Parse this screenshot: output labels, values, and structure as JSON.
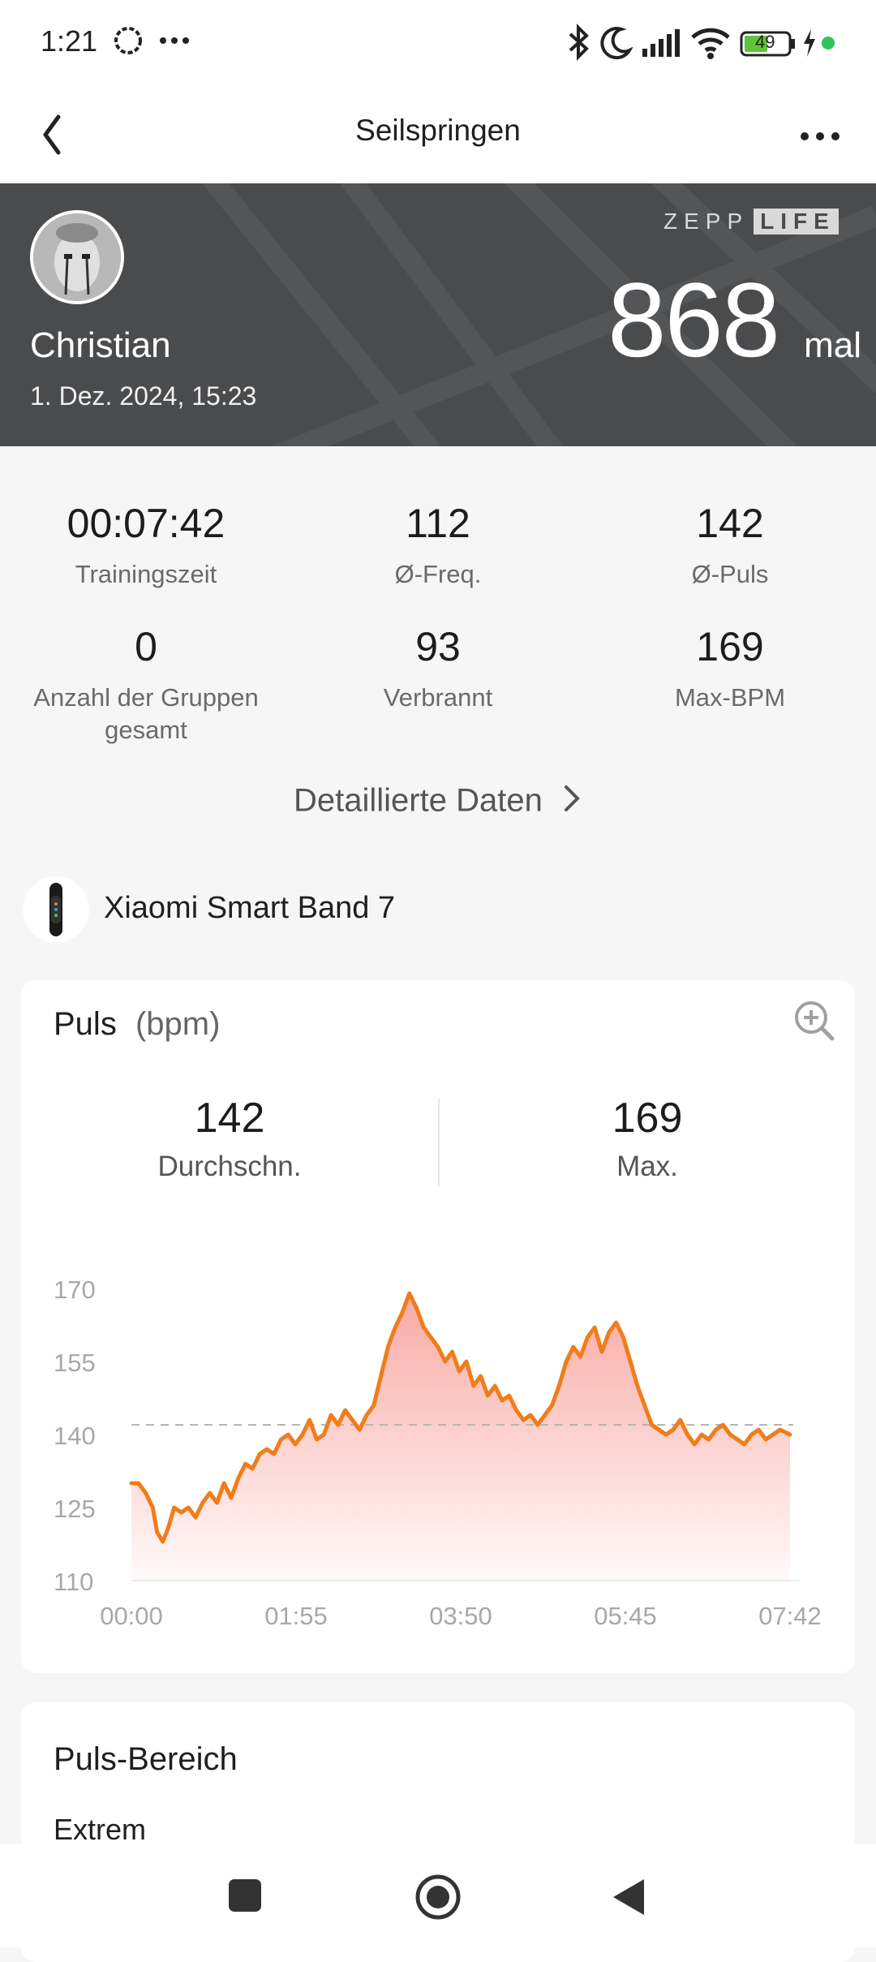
{
  "status_bar": {
    "time": "1:21",
    "battery": "49"
  },
  "nav": {
    "title": "Seilspringen"
  },
  "hero": {
    "brand_logo": "ZEPP LIFE",
    "name": "Christian",
    "date": "1. Dez. 2024, 15:23",
    "count": "868",
    "unit": "mal"
  },
  "stats": [
    {
      "value": "00:07:42",
      "label": "Trainingszeit"
    },
    {
      "value": "112",
      "label": "Ø-Freq."
    },
    {
      "value": "142",
      "label": "Ø-Puls"
    },
    {
      "value": "0",
      "label": "Anzahl der Gruppen gesamt"
    },
    {
      "value": "93",
      "label": "Verbrannt"
    },
    {
      "value": "169",
      "label": "Max-BPM"
    }
  ],
  "detail_link": "Detaillierte Daten",
  "device": {
    "name": "Xiaomi Smart Band 7"
  },
  "pulse_card": {
    "title": "Puls",
    "unit": "(bpm)",
    "avg_value": "142",
    "avg_label": "Durchschn.",
    "max_value": "169",
    "max_label": "Max."
  },
  "chart_data": {
    "type": "area",
    "y_ticks": [
      "170",
      "155",
      "140",
      "125",
      "110"
    ],
    "x_ticks": [
      "00:00",
      "01:55",
      "03:50",
      "05:45",
      "07:42"
    ],
    "ylim": [
      110,
      170
    ],
    "xlim_seconds": [
      0,
      462
    ],
    "average_line": 142,
    "line_color": "#f07d1a",
    "fill_color": "#f8a5a0",
    "series": [
      {
        "values": [
          [
            0,
            130
          ],
          [
            5,
            130
          ],
          [
            10,
            128
          ],
          [
            15,
            125
          ],
          [
            18,
            120
          ],
          [
            22,
            118
          ],
          [
            26,
            121
          ],
          [
            30,
            125
          ],
          [
            35,
            124
          ],
          [
            40,
            125
          ],
          [
            45,
            123
          ],
          [
            50,
            126
          ],
          [
            55,
            128
          ],
          [
            60,
            126
          ],
          [
            65,
            130
          ],
          [
            70,
            127
          ],
          [
            75,
            131
          ],
          [
            80,
            134
          ],
          [
            85,
            133
          ],
          [
            90,
            136
          ],
          [
            95,
            137
          ],
          [
            100,
            136
          ],
          [
            105,
            139
          ],
          [
            110,
            140
          ],
          [
            115,
            138
          ],
          [
            120,
            140
          ],
          [
            125,
            143
          ],
          [
            130,
            139
          ],
          [
            135,
            140
          ],
          [
            140,
            144
          ],
          [
            145,
            142
          ],
          [
            150,
            145
          ],
          [
            155,
            143
          ],
          [
            160,
            141
          ],
          [
            165,
            144
          ],
          [
            170,
            146
          ],
          [
            175,
            152
          ],
          [
            180,
            158
          ],
          [
            185,
            162
          ],
          [
            190,
            165
          ],
          [
            195,
            169
          ],
          [
            200,
            166
          ],
          [
            205,
            162
          ],
          [
            210,
            160
          ],
          [
            215,
            158
          ],
          [
            220,
            155
          ],
          [
            225,
            157
          ],
          [
            230,
            153
          ],
          [
            235,
            155
          ],
          [
            240,
            150
          ],
          [
            245,
            152
          ],
          [
            250,
            148
          ],
          [
            255,
            150
          ],
          [
            260,
            147
          ],
          [
            265,
            148
          ],
          [
            270,
            145
          ],
          [
            275,
            143
          ],
          [
            280,
            144
          ],
          [
            285,
            142
          ],
          [
            290,
            144
          ],
          [
            295,
            146
          ],
          [
            300,
            150
          ],
          [
            305,
            155
          ],
          [
            310,
            158
          ],
          [
            315,
            156
          ],
          [
            320,
            160
          ],
          [
            325,
            162
          ],
          [
            330,
            157
          ],
          [
            335,
            161
          ],
          [
            340,
            163
          ],
          [
            345,
            160
          ],
          [
            350,
            155
          ],
          [
            355,
            150
          ],
          [
            360,
            146
          ],
          [
            365,
            142
          ],
          [
            370,
            141
          ],
          [
            375,
            140
          ],
          [
            380,
            141
          ],
          [
            385,
            143
          ],
          [
            390,
            140
          ],
          [
            395,
            138
          ],
          [
            400,
            140
          ],
          [
            405,
            139
          ],
          [
            410,
            141
          ],
          [
            415,
            142
          ],
          [
            420,
            140
          ],
          [
            425,
            139
          ],
          [
            430,
            138
          ],
          [
            435,
            140
          ],
          [
            440,
            141
          ],
          [
            445,
            139
          ],
          [
            450,
            140
          ],
          [
            455,
            141
          ],
          [
            462,
            140
          ]
        ]
      }
    ]
  },
  "zone_card": {
    "title": "Puls-Bereich",
    "first_zone": "Extrem"
  }
}
